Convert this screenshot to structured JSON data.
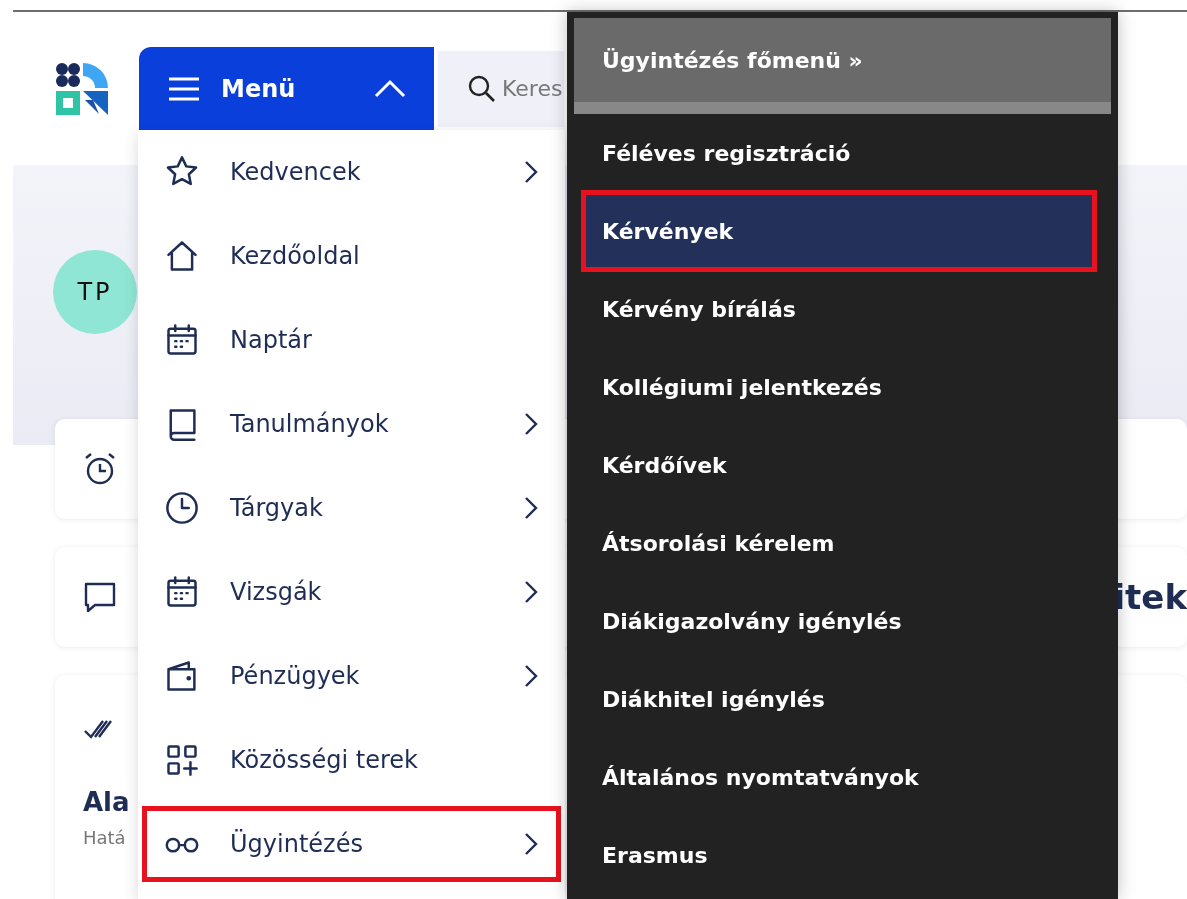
{
  "header": {
    "menu_button": {
      "label": "Menü",
      "expanded": true
    },
    "search": {
      "placeholder": "Keres"
    }
  },
  "profile": {
    "avatar": "TP"
  },
  "notice_card": {
    "title_fragment": "itek"
  },
  "task_card": {
    "title": "Ala",
    "subtitle": "Hatá"
  },
  "menu": {
    "items": [
      {
        "label": "Kedvencek",
        "has_submenu": true,
        "highlighted": false
      },
      {
        "label": "Kezdőoldal",
        "has_submenu": false,
        "highlighted": false
      },
      {
        "label": "Naptár",
        "has_submenu": false,
        "highlighted": false
      },
      {
        "label": "Tanulmányok",
        "has_submenu": true,
        "highlighted": false
      },
      {
        "label": "Tárgyak",
        "has_submenu": true,
        "highlighted": false
      },
      {
        "label": "Vizsgák",
        "has_submenu": true,
        "highlighted": false
      },
      {
        "label": "Pénzügyek",
        "has_submenu": true,
        "highlighted": false
      },
      {
        "label": "Közösségi terek",
        "has_submenu": false,
        "highlighted": false
      },
      {
        "label": "Ügyintézés",
        "has_submenu": true,
        "highlighted": true
      }
    ]
  },
  "submenu": {
    "title": "Ügyintézés főmenü »",
    "items": [
      {
        "label": "Féléves regisztráció",
        "selected": false,
        "highlighted": false
      },
      {
        "label": "Kérvények",
        "selected": true,
        "highlighted": true
      },
      {
        "label": "Kérvény bírálás",
        "selected": false,
        "highlighted": false
      },
      {
        "label": "Kollégiumi jelentkezés",
        "selected": false,
        "highlighted": false
      },
      {
        "label": "Kérdőívek",
        "selected": false,
        "highlighted": false
      },
      {
        "label": "Átsorolási kérelem",
        "selected": false,
        "highlighted": false
      },
      {
        "label": "Diákigazolvány igénylés",
        "selected": false,
        "highlighted": false
      },
      {
        "label": "Diákhitel igénylés",
        "selected": false,
        "highlighted": false
      },
      {
        "label": "Általános nyomtatványok",
        "selected": false,
        "highlighted": false
      },
      {
        "label": "Erasmus",
        "selected": false,
        "highlighted": false
      }
    ]
  }
}
